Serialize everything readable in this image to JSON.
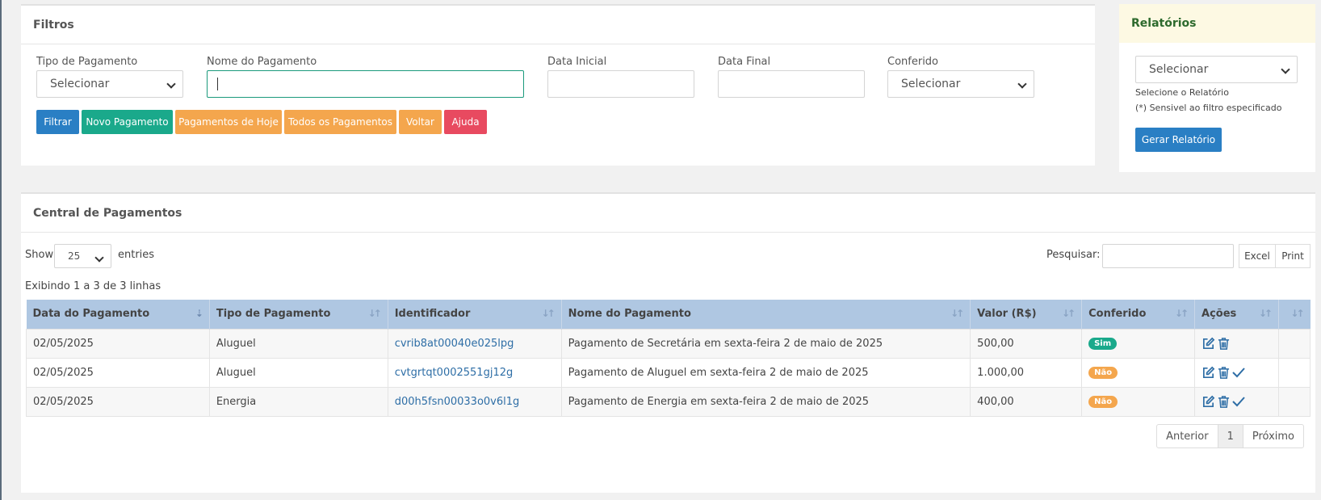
{
  "filtros": {
    "title": "Filtros",
    "tipo_label": "Tipo de Pagamento",
    "tipo_value": "Selecionar",
    "nome_label": "Nome do Pagamento",
    "nome_value": "",
    "data_inicial_label": "Data Inicial",
    "data_final_label": "Data Final",
    "conferido_label": "Conferido",
    "conferido_value": "Selecionar",
    "buttons": {
      "filtrar": "Filtrar",
      "novo": "Novo Pagamento",
      "hoje": "Pagamentos de Hoje",
      "todos": "Todos os Pagamentos",
      "voltar": "Voltar",
      "ajuda": "Ajuda"
    }
  },
  "relatorios": {
    "title": "Relatórios",
    "select_value": "Selecionar",
    "hint1": "Selecione o Relatório",
    "hint2": "(*) Sensivel ao filtro especificado",
    "gerar": "Gerar Relatório"
  },
  "central": {
    "title": "Central de Pagamentos",
    "show": "Show",
    "show_value": "25",
    "entries": "entries",
    "search_label": "Pesquisar:",
    "excel": "Excel",
    "print": "Print",
    "info": "Exibindo 1 a 3 de 3 linhas",
    "columns": [
      "Data do Pagamento",
      "Tipo de Pagamento",
      "Identificador",
      "Nome do Pagamento",
      "Valor (R$)",
      "Conferido",
      "Ações",
      ""
    ],
    "rows": [
      {
        "data": "02/05/2025",
        "tipo": "Aluguel",
        "id": "cvrib8at00040e025lpg",
        "nome": "Pagamento de Secretária em sexta-feira 2 de maio de 2025",
        "valor": "500,00",
        "conferido": "Sim"
      },
      {
        "data": "02/05/2025",
        "tipo": "Aluguel",
        "id": "cvtgrtqt0002551gj12g",
        "nome": "Pagamento de Aluguel em sexta-feira 2 de maio de 2025",
        "valor": "1.000,00",
        "conferido": "Não"
      },
      {
        "data": "02/05/2025",
        "tipo": "Energia",
        "id": "d00h5fsn00033o0v6l1g",
        "nome": "Pagamento de Energia em sexta-feira 2 de maio de 2025",
        "valor": "400,00",
        "conferido": "Não"
      }
    ],
    "pagination": {
      "prev": "Anterior",
      "page": "1",
      "next": "Próximo"
    }
  },
  "colors": {
    "primary": "#2a7fc4",
    "success": "#1aa98b",
    "warning": "#f4a64d",
    "danger": "#e84a60",
    "table_header": "#afc7e2"
  }
}
